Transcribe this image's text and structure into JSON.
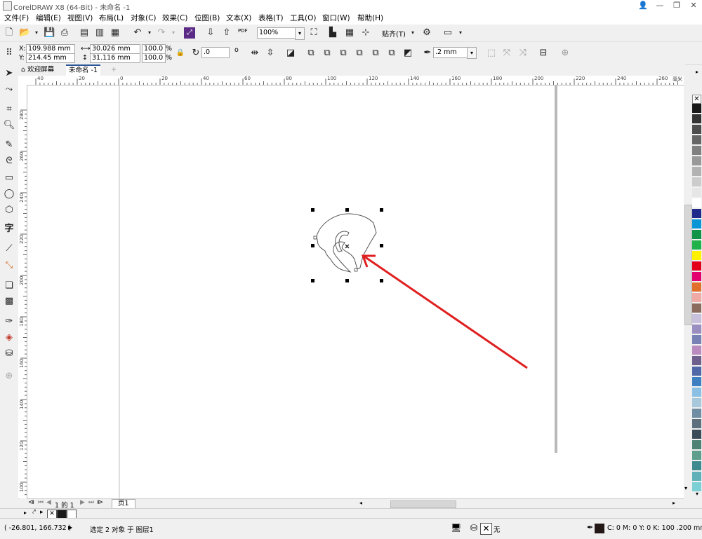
{
  "window": {
    "title": "CorelDRAW X8 (64-Bit) - 未命名 -1",
    "buttons": [
      "▢",
      "—",
      "❐",
      "✕"
    ]
  },
  "menu": [
    "文件(F)",
    "编辑(E)",
    "视图(V)",
    "布局(L)",
    "对象(C)",
    "效果(C)",
    "位图(B)",
    "文本(X)",
    "表格(T)",
    "工具(O)",
    "窗口(W)",
    "帮助(H)"
  ],
  "standard_toolbar": {
    "pdf_label": "PDF",
    "zoom_level": "100%",
    "snap_label": "贴齐(T)"
  },
  "property_bar": {
    "x_label": "X:",
    "x_value": "109.988 mm",
    "y_label": "Y:",
    "y_value": "214.45 mm",
    "width_value": "30.026 mm",
    "height_value": "31.116 mm",
    "scale_x": "100.0",
    "scale_y": "100.0",
    "percent": "%",
    "rotation_value": ".0",
    "degree_symbol": "o",
    "outline_width": ".2 mm"
  },
  "tabs": {
    "welcome": "欢迎屏幕",
    "document": "未命名 -1"
  },
  "ruler": {
    "horizontal_ticks": [
      "40",
      "20",
      "0",
      "20",
      "40",
      "60",
      "80",
      "100",
      "120",
      "140",
      "160",
      "180",
      "200",
      "220",
      "240",
      "260"
    ],
    "unit": "毫米",
    "vertical_ticks": [
      "280",
      "260",
      "240",
      "220",
      "200",
      "180",
      "160",
      "140",
      "120",
      "100"
    ]
  },
  "page_nav": {
    "page_counter": "1 的 1",
    "page_tab": "页1"
  },
  "status": {
    "coordinates": "( -26.801, 166.732 )",
    "selection_info": "选定 2 对象 于 图层1",
    "fill_none": "无",
    "outline_info": "C: 0 M: 0 Y: 0 K: 100  .200 mm"
  },
  "colors": {
    "accent": "#2b579a",
    "arrow": "#e02020",
    "palette": [
      "#1a1a1a",
      "#333333",
      "#4d4d4d",
      "#666666",
      "#808080",
      "#999999",
      "#b3b3b3",
      "#cccccc",
      "#e6e6e6",
      "#ffffff",
      "#1f2a8a",
      "#0a96d6",
      "#119447",
      "#21b34a",
      "#fff100",
      "#e3001b",
      "#e3006f",
      "#e26f2b",
      "#f0aaa5",
      "#8b6b5e",
      "#c9c0dd",
      "#9b8fc1",
      "#7882b4",
      "#b98bbf",
      "#6f5f8c",
      "#5168a8",
      "#3d7fc1",
      "#8cbfe4",
      "#a8c8dc",
      "#6f8ea3",
      "#5e6f7e",
      "#3a4b57",
      "#4f8275",
      "#5e9e8c",
      "#3f8a8e",
      "#5fb0b8",
      "#7ccfd4"
    ]
  }
}
